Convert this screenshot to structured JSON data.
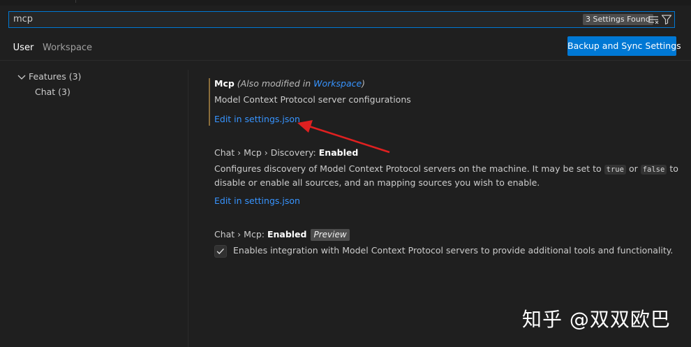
{
  "search": {
    "value": "mcp",
    "results_count": "3 Settings Found"
  },
  "tabs": [
    {
      "label": "User"
    },
    {
      "label": "Workspace"
    }
  ],
  "backup_button": "Backup and Sync Settings",
  "toc": {
    "features": "Features (3)",
    "chat": "Chat (3)"
  },
  "settings": {
    "mcp": {
      "title": "Mcp",
      "modified_prefix": "(Also modified in",
      "modified_link": "Workspace",
      "modified_suffix": ")",
      "description": "Model Context Protocol server configurations",
      "edit_link": "Edit in settings.json"
    },
    "discovery": {
      "category": "Chat › Mcp › Discovery:",
      "name": "Enabled",
      "desc_part1": "Configures discovery of Model Context Protocol servers on the machine. It may be set to",
      "code_true": "true",
      "or": "or",
      "code_false": "false",
      "to": "to",
      "desc_line2": "disable or enable all sources, and an mapping sources you wish to enable.",
      "edit_link": "Edit in settings.json"
    },
    "enabled": {
      "category": "Chat › Mcp:",
      "name": "Enabled",
      "badge": "Preview",
      "checked": true,
      "description": "Enables integration with Model Context Protocol servers to provide additional tools and functionality."
    }
  },
  "watermark": "知乎 @双双欧巴",
  "colors": {
    "accent": "#0078d4",
    "link": "#3794ff",
    "background": "#1f1f1f",
    "annotation_arrow": "#e02020"
  }
}
